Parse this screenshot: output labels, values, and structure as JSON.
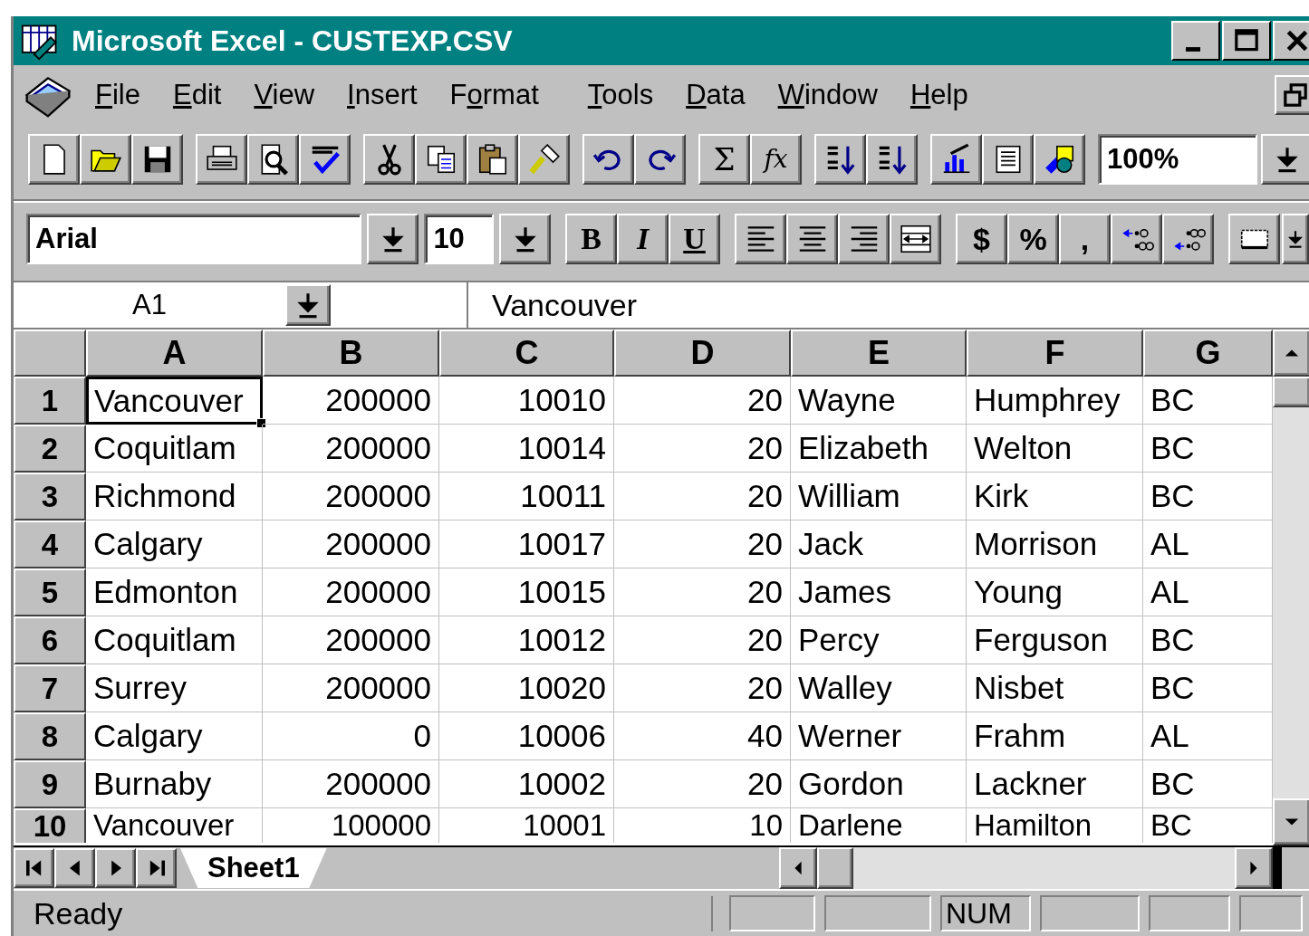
{
  "window": {
    "title": "Microsoft Excel - CUSTEXP.CSV"
  },
  "menu": [
    {
      "key": "F",
      "rest": "ile"
    },
    {
      "key": "E",
      "rest": "dit"
    },
    {
      "key": "V",
      "rest": "iew"
    },
    {
      "key": "I",
      "rest": "nsert"
    },
    {
      "lead": "F",
      "key": "o",
      "rest": "rmat"
    },
    {
      "key": "T",
      "rest": "ools"
    },
    {
      "key": "D",
      "rest": "ata"
    },
    {
      "key": "W",
      "rest": "indow"
    },
    {
      "key": "H",
      "rest": "elp"
    }
  ],
  "standard_toolbar": {
    "groups": [
      [
        {
          "kind": "new"
        },
        {
          "kind": "open"
        },
        {
          "kind": "save"
        }
      ],
      [
        {
          "kind": "print"
        },
        {
          "kind": "preview"
        },
        {
          "kind": "spell"
        }
      ],
      [
        {
          "kind": "cut"
        },
        {
          "kind": "copy"
        },
        {
          "kind": "paste"
        },
        {
          "kind": "painter"
        }
      ],
      [
        {
          "kind": "undo"
        },
        {
          "kind": "redo"
        }
      ],
      [
        {
          "kind": "sum",
          "label": "Σ"
        },
        {
          "kind": "function",
          "label": "fx"
        }
      ],
      [
        {
          "kind": "sort-asc"
        },
        {
          "kind": "sort-desc"
        }
      ],
      [
        {
          "kind": "chart"
        },
        {
          "kind": "textbox"
        },
        {
          "kind": "draw"
        }
      ]
    ],
    "zoom_field": {
      "value": "100%"
    }
  },
  "formatting_toolbar": {
    "font_field": {
      "value": "Arial"
    },
    "size_field": {
      "value": "10"
    },
    "groups": [
      [
        {
          "kind": "bold",
          "label": "B"
        },
        {
          "kind": "italic",
          "label": "I"
        },
        {
          "kind": "underline",
          "label": "U"
        }
      ],
      [
        {
          "kind": "align-left"
        },
        {
          "kind": "align-center"
        },
        {
          "kind": "align-right"
        },
        {
          "kind": "merge"
        }
      ],
      [
        {
          "kind": "plain",
          "label": "$"
        },
        {
          "kind": "plain",
          "label": "%"
        },
        {
          "kind": "plain",
          "label": ","
        },
        {
          "kind": "inc-decimal"
        },
        {
          "kind": "dec-decimal"
        }
      ],
      [
        {
          "kind": "borders"
        }
      ]
    ]
  },
  "formula_bar": {
    "name_box": "A1",
    "content": "Vancouver"
  },
  "grid": {
    "columns": [
      {
        "label": "A",
        "kind": "text"
      },
      {
        "label": "B",
        "kind": "number"
      },
      {
        "label": "C",
        "kind": "number"
      },
      {
        "label": "D",
        "kind": "number"
      },
      {
        "label": "E",
        "kind": "text"
      },
      {
        "label": "F",
        "kind": "text"
      },
      {
        "label": "G",
        "kind": "text"
      }
    ],
    "rows": [
      {
        "header": "1",
        "cells": [
          {
            "text": "Vancouver",
            "selected": true
          },
          {
            "text": "200000",
            "selected": false
          },
          {
            "text": "10010",
            "selected": false
          },
          {
            "text": "20",
            "selected": false
          },
          {
            "text": "Wayne",
            "selected": false
          },
          {
            "text": "Humphrey",
            "selected": false
          },
          {
            "text": "BC",
            "selected": false
          }
        ]
      },
      {
        "header": "2",
        "cells": [
          {
            "text": "Coquitlam",
            "selected": false
          },
          {
            "text": "200000",
            "selected": false
          },
          {
            "text": "10014",
            "selected": false
          },
          {
            "text": "20",
            "selected": false
          },
          {
            "text": "Elizabeth",
            "selected": false
          },
          {
            "text": "Welton",
            "selected": false
          },
          {
            "text": "BC",
            "selected": false
          }
        ]
      },
      {
        "header": "3",
        "cells": [
          {
            "text": "Richmond",
            "selected": false
          },
          {
            "text": "200000",
            "selected": false
          },
          {
            "text": "10011",
            "selected": false
          },
          {
            "text": "20",
            "selected": false
          },
          {
            "text": "William",
            "selected": false
          },
          {
            "text": "Kirk",
            "selected": false
          },
          {
            "text": "BC",
            "selected": false
          }
        ]
      },
      {
        "header": "4",
        "cells": [
          {
            "text": "Calgary",
            "selected": false
          },
          {
            "text": "200000",
            "selected": false
          },
          {
            "text": "10017",
            "selected": false
          },
          {
            "text": "20",
            "selected": false
          },
          {
            "text": "Jack",
            "selected": false
          },
          {
            "text": "Morrison",
            "selected": false
          },
          {
            "text": "AL",
            "selected": false
          }
        ]
      },
      {
        "header": "5",
        "cells": [
          {
            "text": "Edmonton",
            "selected": false
          },
          {
            "text": "200000",
            "selected": false
          },
          {
            "text": "10015",
            "selected": false
          },
          {
            "text": "20",
            "selected": false
          },
          {
            "text": "James",
            "selected": false
          },
          {
            "text": "Young",
            "selected": false
          },
          {
            "text": "AL",
            "selected": false
          }
        ]
      },
      {
        "header": "6",
        "cells": [
          {
            "text": "Coquitlam",
            "selected": false
          },
          {
            "text": "200000",
            "selected": false
          },
          {
            "text": "10012",
            "selected": false
          },
          {
            "text": "20",
            "selected": false
          },
          {
            "text": "Percy",
            "selected": false
          },
          {
            "text": "Ferguson",
            "selected": false
          },
          {
            "text": "BC",
            "selected": false
          }
        ]
      },
      {
        "header": "7",
        "cells": [
          {
            "text": "Surrey",
            "selected": false
          },
          {
            "text": "200000",
            "selected": false
          },
          {
            "text": "10020",
            "selected": false
          },
          {
            "text": "20",
            "selected": false
          },
          {
            "text": "Walley",
            "selected": false
          },
          {
            "text": "Nisbet",
            "selected": false
          },
          {
            "text": "BC",
            "selected": false
          }
        ]
      },
      {
        "header": "8",
        "cells": [
          {
            "text": "Calgary",
            "selected": false
          },
          {
            "text": "0",
            "selected": false
          },
          {
            "text": "10006",
            "selected": false
          },
          {
            "text": "40",
            "selected": false
          },
          {
            "text": "Werner",
            "selected": false
          },
          {
            "text": "Frahm",
            "selected": false
          },
          {
            "text": "AL",
            "selected": false
          }
        ]
      },
      {
        "header": "9",
        "cells": [
          {
            "text": "Burnaby",
            "selected": false
          },
          {
            "text": "200000",
            "selected": false
          },
          {
            "text": "10002",
            "selected": false
          },
          {
            "text": "20",
            "selected": false
          },
          {
            "text": "Gordon",
            "selected": false
          },
          {
            "text": "Lackner",
            "selected": false
          },
          {
            "text": "BC",
            "selected": false
          }
        ]
      },
      {
        "header": "10",
        "cells": [
          {
            "text": "Vancouver",
            "selected": false
          },
          {
            "text": "100000",
            "selected": false
          },
          {
            "text": "10001",
            "selected": false
          },
          {
            "text": "10",
            "selected": false
          },
          {
            "text": "Darlene",
            "selected": false
          },
          {
            "text": "Hamilton",
            "selected": false
          },
          {
            "text": "BC",
            "selected": false
          }
        ]
      }
    ]
  },
  "sheet_tabs": [
    {
      "label": "Sheet1",
      "selected": true
    }
  ],
  "status_bar": {
    "message": "Ready",
    "indicators": [
      "NUM"
    ]
  }
}
